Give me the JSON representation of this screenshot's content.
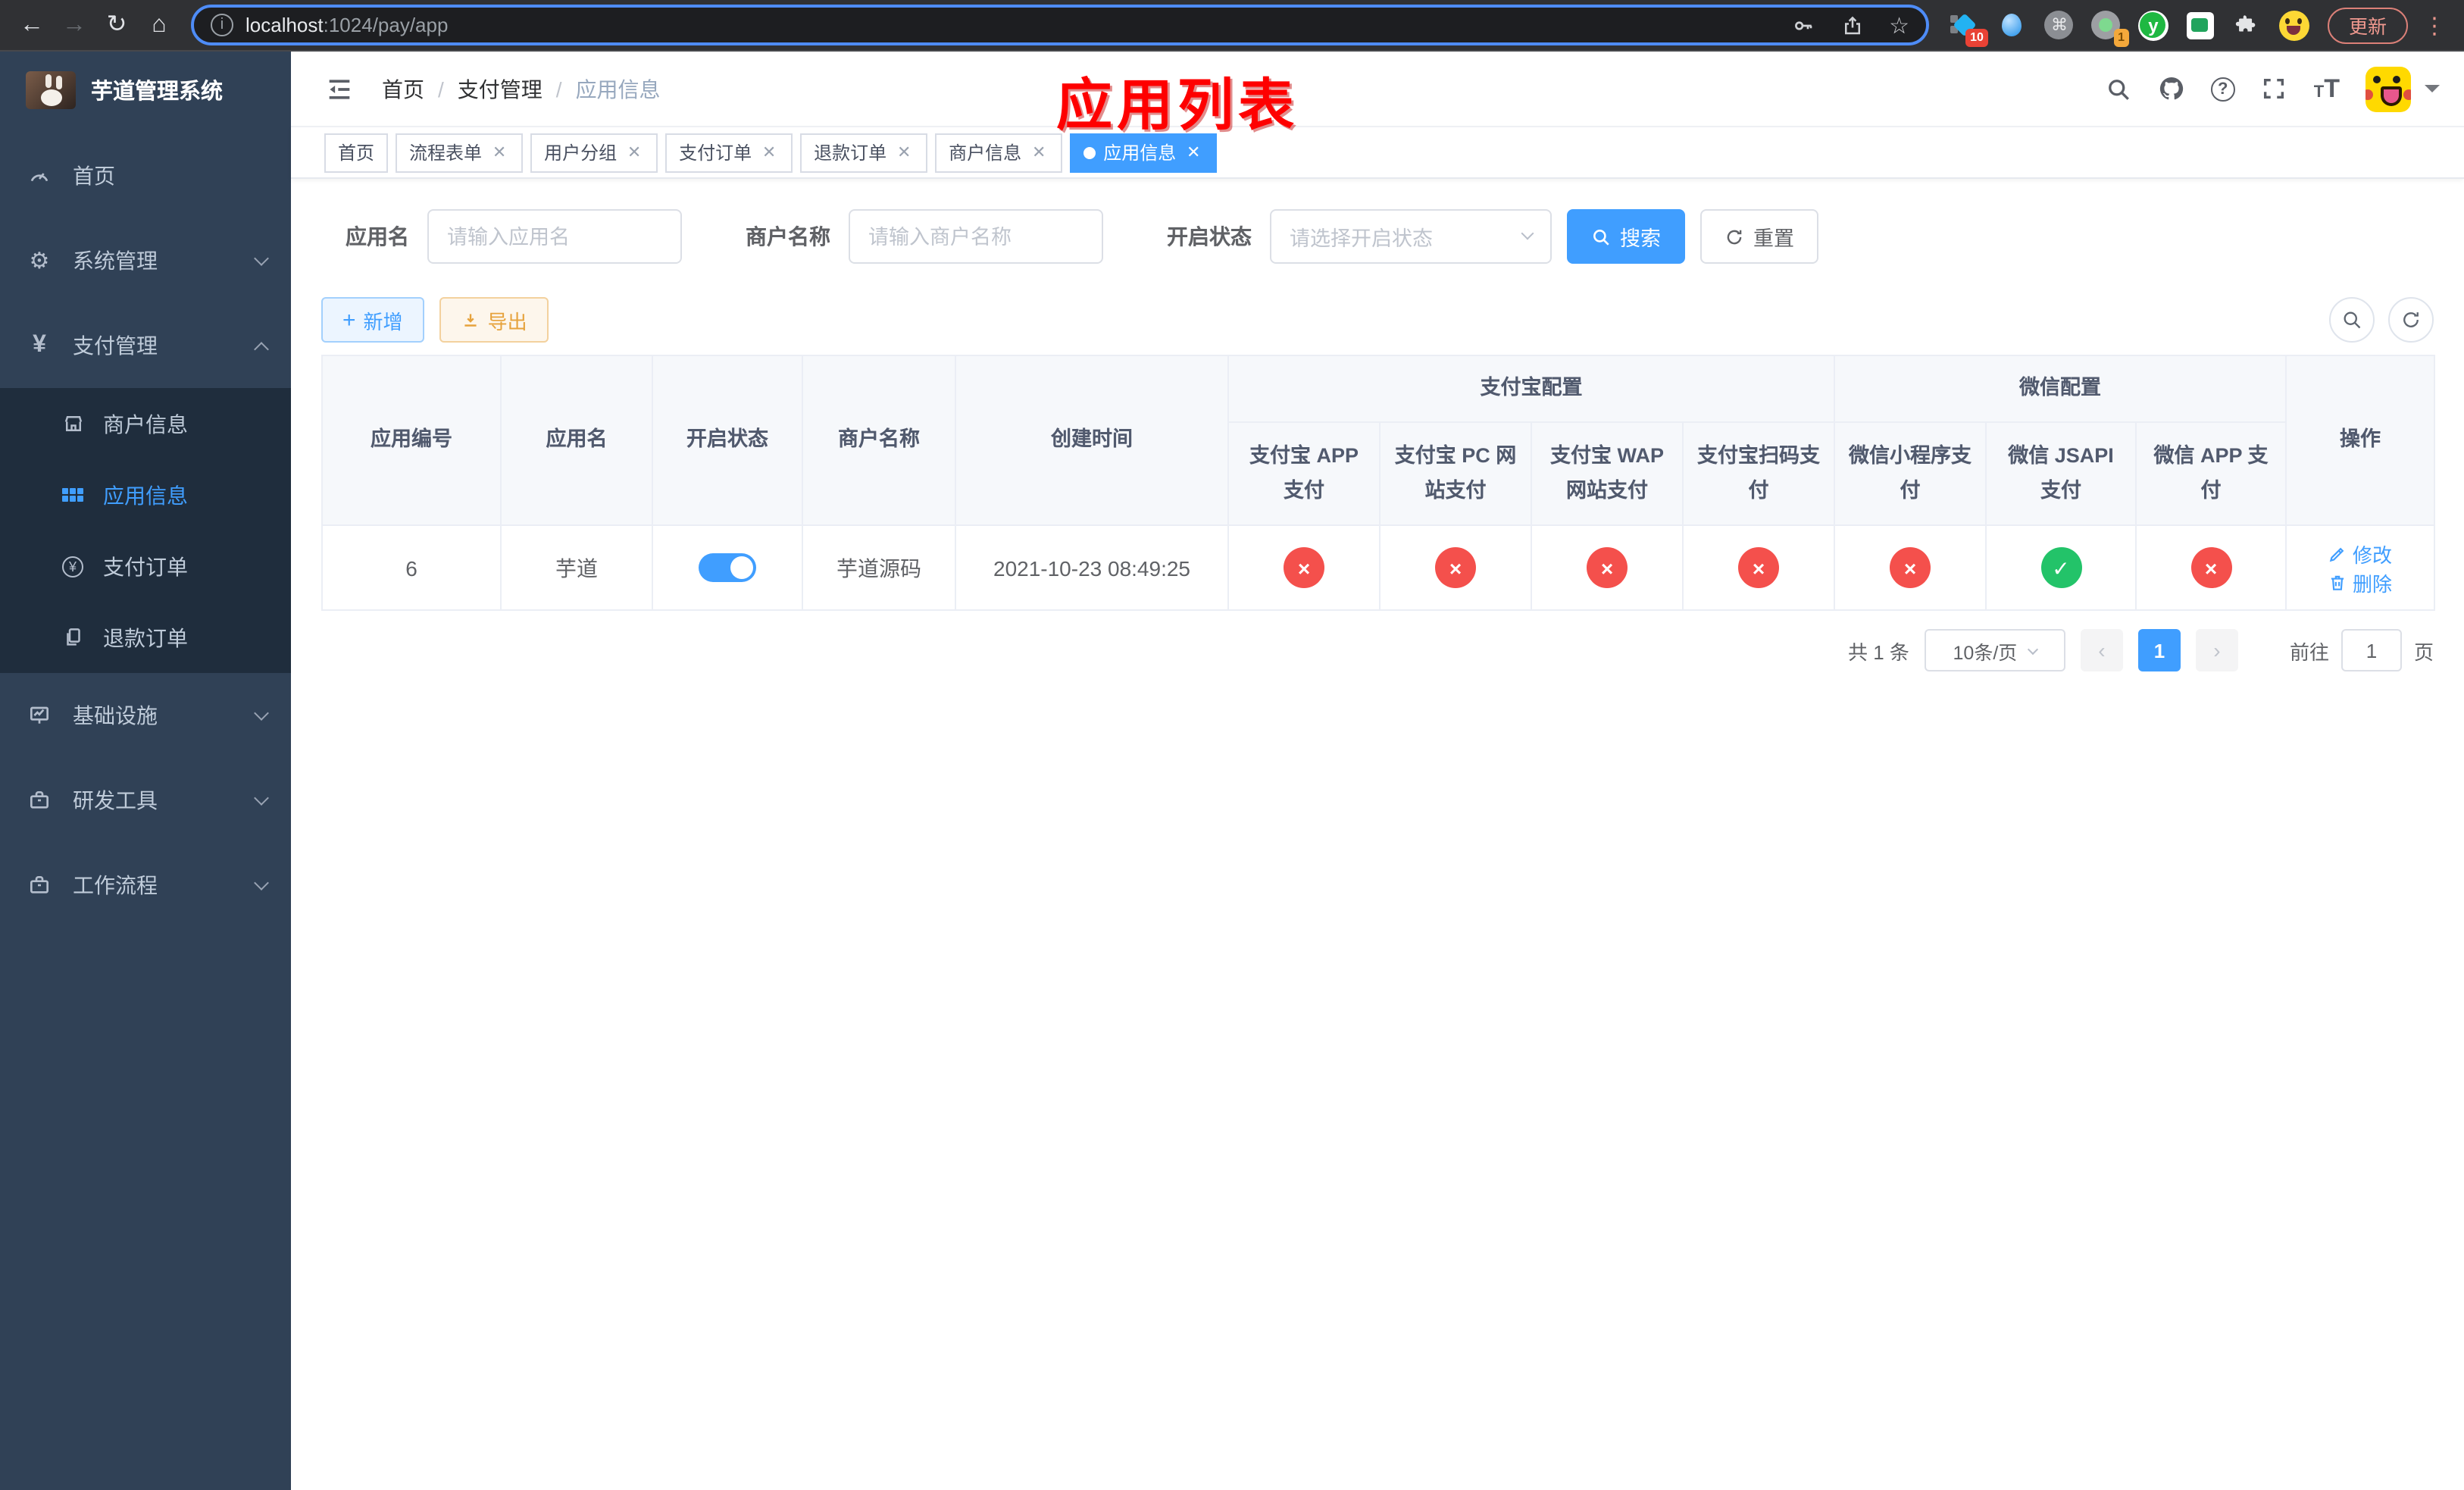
{
  "browser": {
    "url_host": "localhost",
    "url_path": ":1024/pay/app",
    "update_button": "更新",
    "ext_badge_tag": "10",
    "ext_badge_rec": "1"
  },
  "sidebar": {
    "title": "芋道管理系统",
    "items": [
      {
        "label": "首页"
      },
      {
        "label": "系统管理"
      },
      {
        "label": "支付管理"
      },
      {
        "label": "基础设施"
      },
      {
        "label": "研发工具"
      },
      {
        "label": "工作流程"
      }
    ],
    "submenu": [
      {
        "label": "商户信息"
      },
      {
        "label": "应用信息"
      },
      {
        "label": "支付订单"
      },
      {
        "label": "退款订单"
      }
    ]
  },
  "header": {
    "breadcrumb": [
      "首页",
      "支付管理",
      "应用信息"
    ],
    "annotation": "应用列表"
  },
  "tabs": [
    {
      "label": "首页",
      "closable": false,
      "active": false
    },
    {
      "label": "流程表单",
      "closable": true,
      "active": false
    },
    {
      "label": "用户分组",
      "closable": true,
      "active": false
    },
    {
      "label": "支付订单",
      "closable": true,
      "active": false
    },
    {
      "label": "退款订单",
      "closable": true,
      "active": false
    },
    {
      "label": "商户信息",
      "closable": true,
      "active": false
    },
    {
      "label": "应用信息",
      "closable": true,
      "active": true
    }
  ],
  "filters": {
    "app_name_label": "应用名",
    "app_name_placeholder": "请输入应用名",
    "merchant_label": "商户名称",
    "merchant_placeholder": "请输入商户名称",
    "status_label": "开启状态",
    "status_placeholder": "请选择开启状态",
    "search_button": "搜索",
    "reset_button": "重置"
  },
  "toolbar": {
    "add_button": "新增",
    "export_button": "导出"
  },
  "table": {
    "columns": [
      "应用编号",
      "应用名",
      "开启状态",
      "商户名称",
      "创建时间"
    ],
    "groups": [
      {
        "label": "支付宝配置",
        "children": [
          "支付宝 APP 支付",
          "支付宝 PC 网站支付",
          "支付宝 WAP 网站支付",
          "支付宝扫码支付"
        ]
      },
      {
        "label": "微信配置",
        "children": [
          "微信小程序支付",
          "微信 JSAPI 支付",
          "微信 APP 支付"
        ]
      }
    ],
    "action_column": "操作",
    "rows": [
      {
        "id": "6",
        "name": "芋道",
        "enabled": true,
        "merchant": "芋道源码",
        "created_at": "2021-10-23 08:49:25",
        "channels": [
          false,
          false,
          false,
          false,
          false,
          true,
          false
        ],
        "actions": [
          "修改",
          "删除"
        ]
      }
    ]
  },
  "pagination": {
    "total": "共 1 条",
    "page_size": "10条/页",
    "page": "1",
    "goto_label": "前往",
    "goto_value": "1",
    "page_unit": "页"
  },
  "colors": {
    "primary": "#409eff",
    "danger": "#f4504c",
    "success": "#23c369",
    "annotation_red": "#fe0000",
    "sidebar_bg": "#304156",
    "submenu_bg": "#1f2d3d",
    "warning": "#e6a23c"
  }
}
